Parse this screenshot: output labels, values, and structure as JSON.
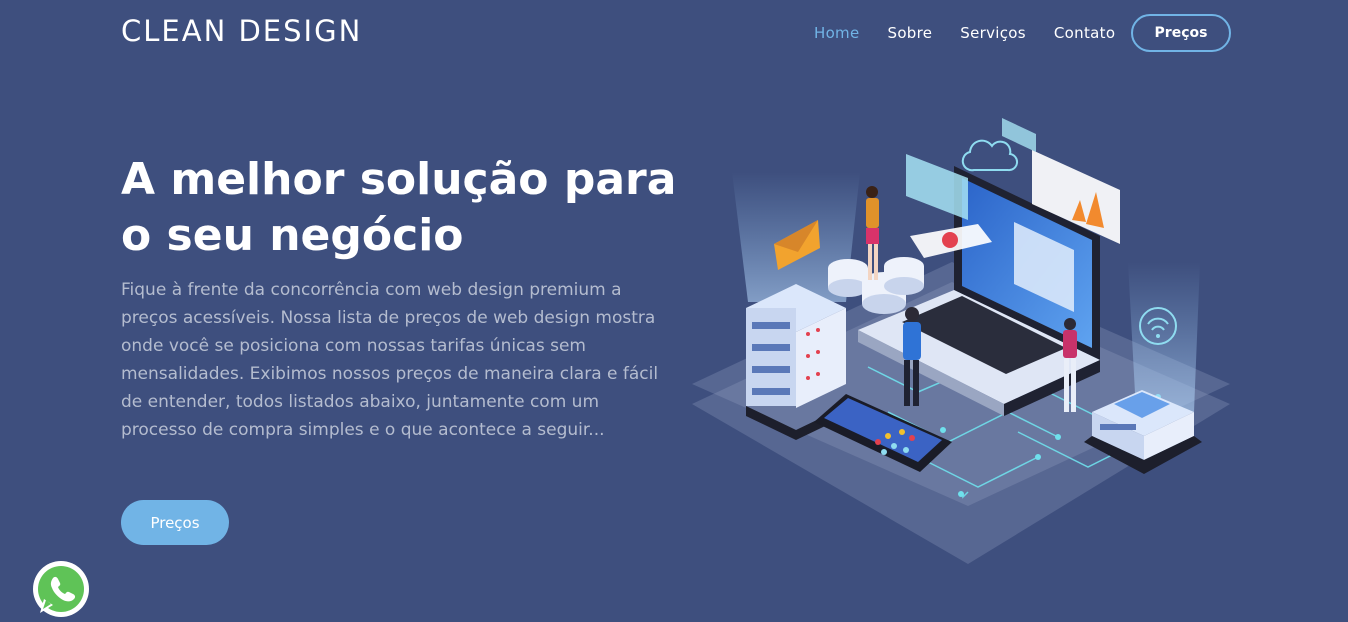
{
  "header": {
    "logo": "CLEAN DESIGN",
    "nav": [
      {
        "label": "Home",
        "active": true
      },
      {
        "label": "Sobre",
        "active": false
      },
      {
        "label": "Serviços",
        "active": false
      },
      {
        "label": "Contato",
        "active": false
      }
    ],
    "cta_label": "Preços"
  },
  "hero": {
    "title": "A melhor solução para o seu negócio",
    "text": "Fique à frente da concorrência com web design premium a preços acessíveis. Nossa lista de preços de web design mostra onde você se posiciona com nossas tarifas únicas sem mensalidades. Exibimos nossos preços de maneira clara e fácil de entender, todos listados abaixo, juntamente com um processo de compra simples e o que acontece a seguir...",
    "button_label": "Preços"
  },
  "colors": {
    "background": "#3e4f7e",
    "accent": "#71b4e6",
    "body_text": "#b4bccf"
  },
  "icons": {
    "whatsapp": "whatsapp-icon"
  }
}
